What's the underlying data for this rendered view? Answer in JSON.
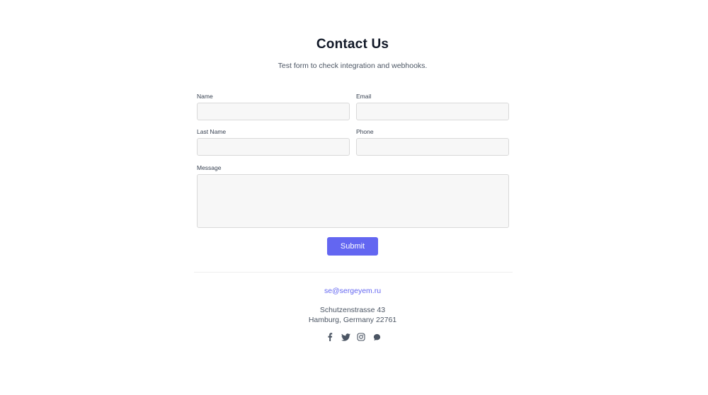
{
  "header": {
    "title": "Contact Us",
    "subtitle": "Test form to check integration and webhooks."
  },
  "form": {
    "name_label": "Name",
    "name_value": "",
    "email_label": "Email",
    "email_value": "",
    "last_name_label": "Last Name",
    "last_name_value": "",
    "phone_label": "Phone",
    "phone_value": "",
    "message_label": "Message",
    "message_value": "",
    "submit_label": "Submit"
  },
  "footer": {
    "email": "se@sergeyem.ru",
    "address_line1": "Schutzenstrasse 43",
    "address_line2": "Hamburg, Germany 22761",
    "socials": [
      {
        "icon": "facebook-icon"
      },
      {
        "icon": "twitter-icon"
      },
      {
        "icon": "instagram-icon"
      },
      {
        "icon": "chat-bubble-icon"
      }
    ]
  },
  "colors": {
    "accent": "#6366f1",
    "input_bg": "#f7f7f7",
    "input_border": "#d9d9d9",
    "text_dark": "#111827",
    "text_muted": "#4b5563"
  }
}
